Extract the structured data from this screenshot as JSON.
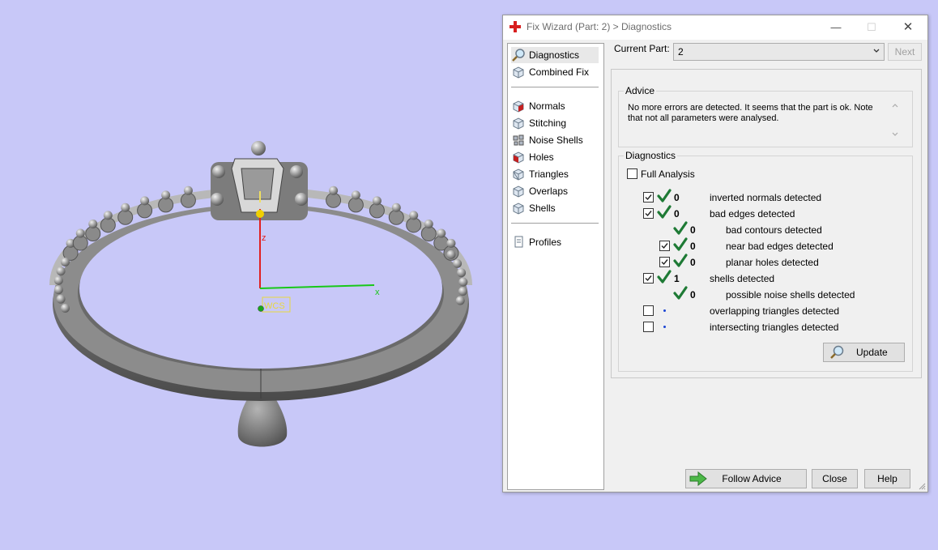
{
  "window": {
    "title": "Fix Wizard (Part: 2) > Diagnostics",
    "minimize": "—",
    "maximize": "☐",
    "close": "✕"
  },
  "nav": {
    "top_items": [
      {
        "label": "Diagnostics",
        "icon": "magnifier-icon",
        "selected": true
      },
      {
        "label": "Combined Fix",
        "icon": "cube-icon",
        "selected": false
      }
    ],
    "items": [
      {
        "label": "Normals",
        "icon": "normals-cube-icon"
      },
      {
        "label": "Stitching",
        "icon": "stitching-cube-icon"
      },
      {
        "label": "Noise Shells",
        "icon": "noise-shells-icon"
      },
      {
        "label": "Holes",
        "icon": "holes-cube-icon"
      },
      {
        "label": "Triangles",
        "icon": "triangles-cube-icon"
      },
      {
        "label": "Overlaps",
        "icon": "overlaps-cube-icon"
      },
      {
        "label": "Shells",
        "icon": "shells-cube-icon"
      }
    ],
    "bottom_items": [
      {
        "label": "Profiles",
        "icon": "document-icon"
      }
    ]
  },
  "current_part": {
    "label": "Current Part:",
    "value": "2",
    "next_label": "Next"
  },
  "advice": {
    "title": "Advice",
    "text": "No more errors are detected. It seems that the part is ok. Note that not all parameters were analysed."
  },
  "diagnostics": {
    "title": "Diagnostics",
    "full_analysis_label": "Full Analysis",
    "full_analysis_checked": false,
    "rows": [
      {
        "checked": true,
        "status": "ok",
        "count": "0",
        "label": "inverted normals detected",
        "indent": 0,
        "has_checkbox": true
      },
      {
        "checked": true,
        "status": "ok",
        "count": "0",
        "label": "bad edges detected",
        "indent": 0,
        "has_checkbox": true
      },
      {
        "checked": false,
        "status": "ok",
        "count": "0",
        "label": "bad contours detected",
        "indent": 1,
        "has_checkbox": false
      },
      {
        "checked": true,
        "status": "ok",
        "count": "0",
        "label": "near bad edges detected",
        "indent": 1,
        "has_checkbox": true
      },
      {
        "checked": true,
        "status": "ok",
        "count": "0",
        "label": "planar holes detected",
        "indent": 1,
        "has_checkbox": true
      },
      {
        "checked": true,
        "status": "ok",
        "count": "1",
        "label": "shells detected",
        "indent": 0,
        "has_checkbox": true
      },
      {
        "checked": false,
        "status": "ok",
        "count": "0",
        "label": "possible noise shells detected",
        "indent": 1,
        "has_checkbox": false
      },
      {
        "checked": false,
        "status": "none",
        "count": "",
        "label": "overlapping triangles detected",
        "indent": 0,
        "has_checkbox": true
      },
      {
        "checked": false,
        "status": "none",
        "count": "",
        "label": "intersecting triangles detected",
        "indent": 0,
        "has_checkbox": true
      }
    ],
    "update_label": "Update"
  },
  "footer": {
    "follow_advice_label": "Follow Advice",
    "close_label": "Close",
    "help_label": "Help"
  },
  "viewport": {
    "axis_x": "x",
    "axis_z": "z",
    "wcs_label": "WCS",
    "background": "#c8c8f8"
  },
  "colors": {
    "check_green": "#1e7a35",
    "dot_blue": "#1a44d4",
    "accent_red": "#d81e1e"
  }
}
